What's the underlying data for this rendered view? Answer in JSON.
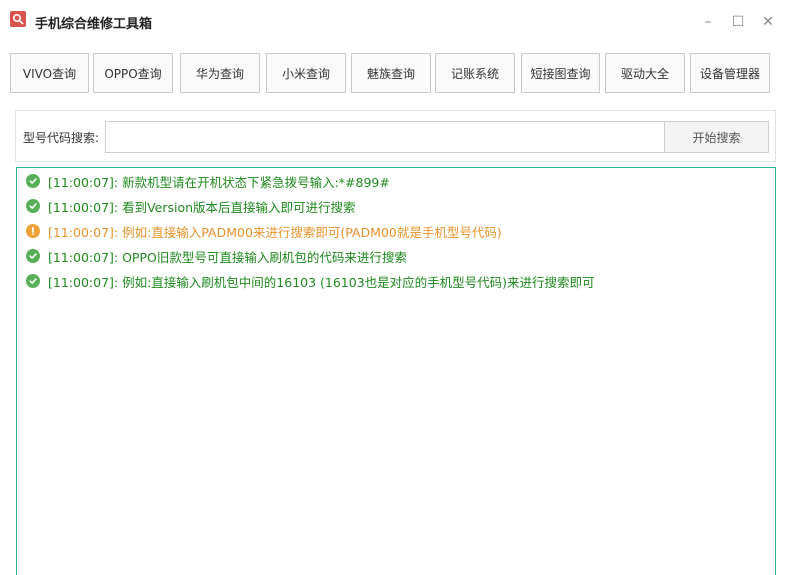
{
  "window": {
    "title": "手机综合维修工具箱",
    "icon": "search-icon",
    "controls": {
      "minimize": "–",
      "maximize": "☐",
      "close": "✕"
    }
  },
  "toolbar": {
    "buttons": [
      "VIVO查询",
      "OPPO查询",
      "华为查询",
      "小米查询",
      "魅族查询",
      "记账系统",
      "短接图查询",
      "驱动大全",
      "设备管理器"
    ]
  },
  "search": {
    "label": "型号代码搜索:",
    "value": "",
    "button_label": "开始搜索"
  },
  "log": {
    "colors": {
      "ok": "#1f8a1f",
      "warn": "#e8922a",
      "border": "#27b3a3"
    },
    "entries": [
      {
        "type": "ok",
        "icon": "check-circle-icon",
        "text": "[11:00:07]: 新款机型请在开机状态下紧急拨号输入:*#899#"
      },
      {
        "type": "ok",
        "icon": "check-circle-icon",
        "text": "[11:00:07]: 看到Version版本后直接输入即可进行搜索"
      },
      {
        "type": "warn",
        "icon": "warning-circle-icon",
        "text": "[11:00:07]: 例如:直接输入PADM00来进行搜索即可(PADM00就是手机型号代码)"
      },
      {
        "type": "ok",
        "icon": "check-circle-icon",
        "text": "[11:00:07]: OPPO旧款型号可直接输入刷机包的代码来进行搜索"
      },
      {
        "type": "ok",
        "icon": "check-circle-icon",
        "text": "[11:00:07]: 例如:直接输入刷机包中间的16103 (16103也是对应的手机型号代码)来进行搜索即可"
      }
    ]
  }
}
